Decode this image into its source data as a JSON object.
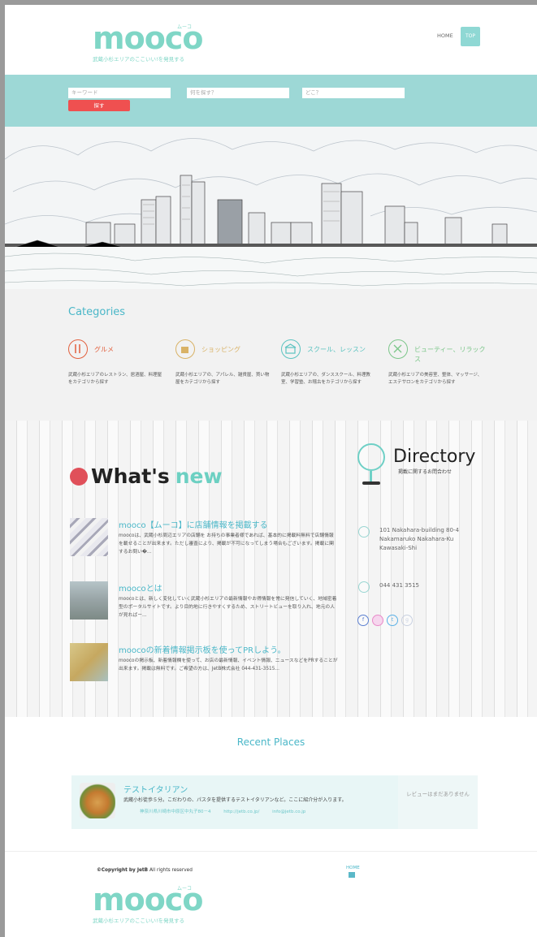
{
  "header": {
    "logo_text": "mooco",
    "logo_kana": "ムーコ",
    "logo_tagline": "武蔵小杉エリアのここいい!を発見する",
    "nav_home": "HOME",
    "nav_top": "TOP"
  },
  "search": {
    "keyword_placeholder": "キーワード",
    "what_placeholder": "何を探す？",
    "where_placeholder": "どこ？",
    "button": "探す"
  },
  "categories": {
    "title": "Categories",
    "items": [
      {
        "icon": "cutlery-icon",
        "name": "グルメ",
        "desc": "武蔵小杉エリアのレストラン、居酒屋、料理屋をカテゴリから探す",
        "color": "#e2603e"
      },
      {
        "icon": "shopping-bag-icon",
        "name": "ショッピング",
        "desc": "武蔵小杉エリアの、アパレル、雑貨屋、買い物屋をカテゴリから探す",
        "color": "#d9b266"
      },
      {
        "icon": "school-icon",
        "name": "スクール、レッスン",
        "desc": "武蔵小杉エリアの、ダンススクール、料理教室、学習塾、お稽古をカテゴリから探す",
        "color": "#5bc3c0"
      },
      {
        "icon": "scissors-icon",
        "name": "ビューティー、リラックス",
        "desc": "武蔵小杉エリアの美容室、整体、マッサージ、エステサロンをカテゴリから探す",
        "color": "#7cc68a"
      }
    ]
  },
  "news": {
    "title_a": "What's",
    "title_b": "new",
    "items": [
      {
        "title": "mooco【ムーコ】に店舗情報を掲載する",
        "body": "moocoは、武蔵小杉周辺エリアの店舗を お持ちの事業者様であれば、基本的に掲載料無料で店舗情報を載せることが出来ます。ただし審査により、掲載が不可になってしまう場合もございます。掲載に関するお問い�..."
      },
      {
        "title": "moocoとは",
        "body": "moocoとは、新しく変化していく武蔵小杉エリアの最新情報やお得情報を常に発信していく、地域密着型のポータルサイトです。より目的地に行きやすくするため、ストリートビューを取り入れ、地元の人が見ればー..."
      },
      {
        "title": "moocoの新着情報掲示板を使ってPRしよう。",
        "body": "moocoの掲示板、新着情報欄を使って、お店の最新情報、イベント情報、ニュースなどをPRすることが出来ます。掲載は無料です。ご希望の方は、JetB株式会社 044-431-3515..."
      }
    ]
  },
  "directory": {
    "title": "Directory",
    "subtitle": "掲載に関するお問合わせ",
    "address": "101 Nakahara-building 80-4 Nakamaruko Nakahara-Ku Kawasaki-Shi",
    "phone": "044 431 3515",
    "social": [
      "f",
      "",
      "t",
      "g"
    ]
  },
  "recent": {
    "title": "Recent Places",
    "place_name": "テストイタリアン",
    "place_desc": "武蔵小杉徒歩５分。こだわりの、パスタを提供するテストイタリアンなど。ここに紹介分が入ります。",
    "place_address": "神奈川県川崎市中原区中丸子80－4",
    "place_url": "http://jetb.co.jp/",
    "place_email": "info@jetb.co.jp",
    "review": "レビューはまだありません"
  },
  "footer": {
    "copyright_bold": "©Copyright by JetB",
    "copyright_rest": " All rights reserved",
    "home": "HOME"
  }
}
